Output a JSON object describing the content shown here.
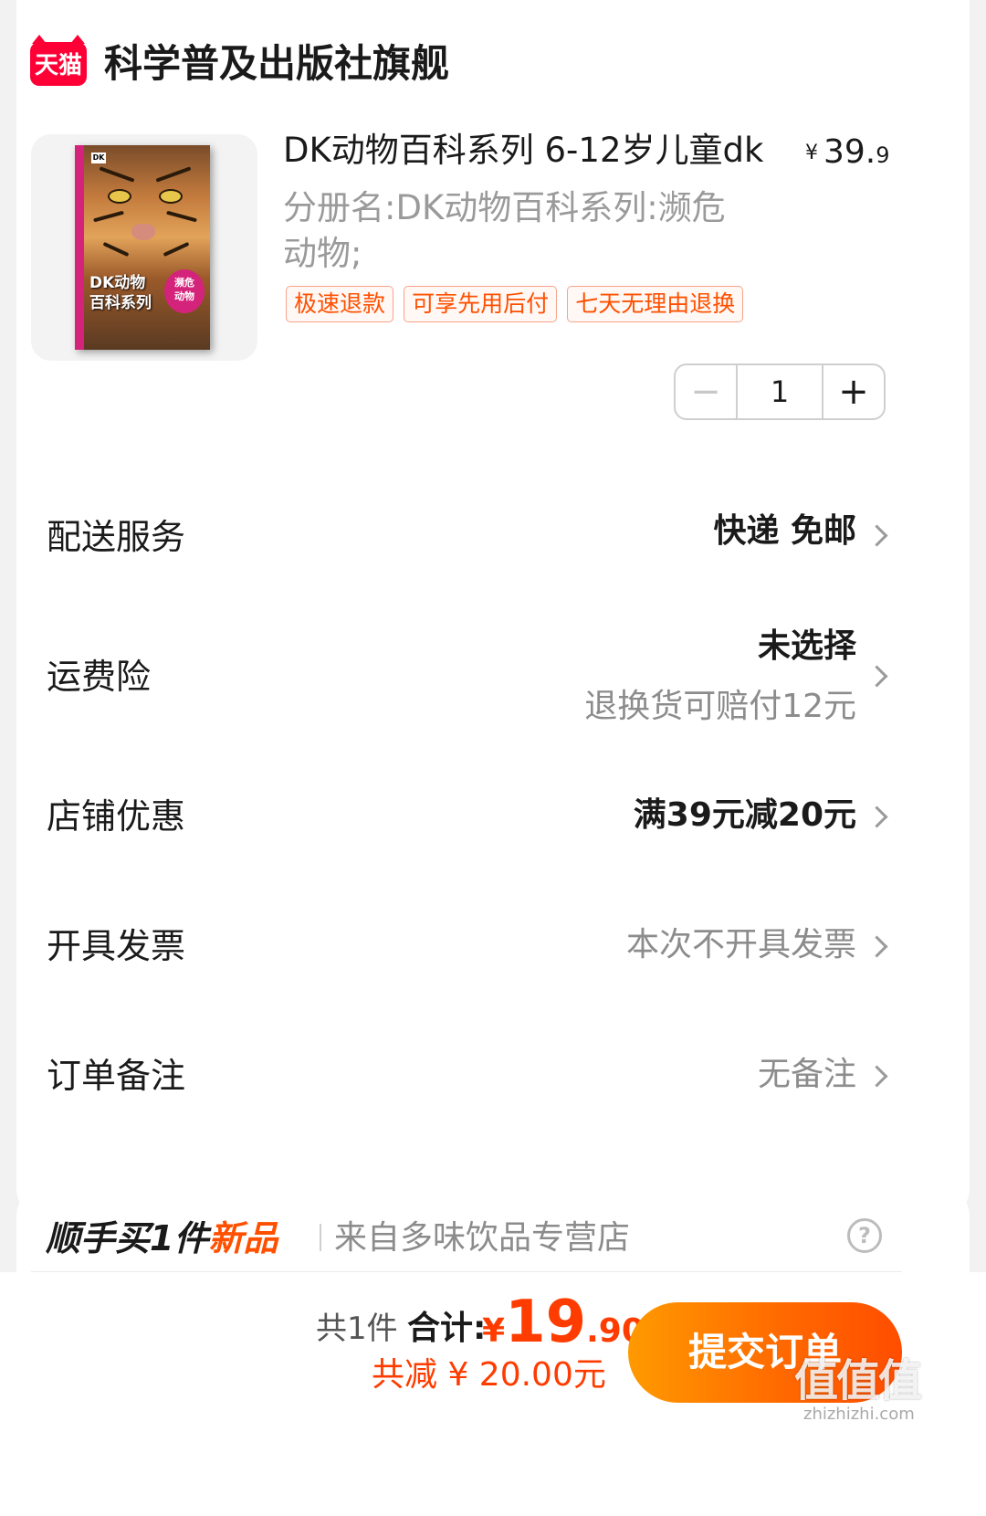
{
  "shop": {
    "logo_text": "天猫",
    "name": "科学普及出版社旗舰"
  },
  "product": {
    "title": "DK动物百科系列 6-12岁儿童dk",
    "price_currency": "¥",
    "price_int": "39.",
    "price_dec": "9",
    "sku": "分册名:DK动物百科系列:濒危动物;",
    "cover": {
      "title_line1": "DK动物",
      "title_line2": "百科系列",
      "badge_line1": "濒危",
      "badge_line2": "动物",
      "logo": "DK"
    },
    "tags": [
      "极速退款",
      "可享先用后付",
      "七天无理由退换"
    ],
    "quantity": "1",
    "minus": "−",
    "plus": "+"
  },
  "rows": {
    "delivery": {
      "label": "配送服务",
      "value": "快递 免邮"
    },
    "insurance": {
      "label": "运费险",
      "value": "未选择",
      "sub": "退换货可赔付12元"
    },
    "discount": {
      "label": "店铺优惠",
      "value": "满39元减20元"
    },
    "invoice": {
      "label": "开具发票",
      "value": "本次不开具发票"
    },
    "note": {
      "label": "订单备注",
      "value": "无备注"
    }
  },
  "addon": {
    "title_prefix": "顺手买1件",
    "title_highlight": "新品",
    "from": "来自多味饮品专营店",
    "help": "?"
  },
  "footer": {
    "count": "共1件",
    "total_label": "合计:",
    "total_currency": "¥",
    "total_int": "19",
    "total_dec": ".90",
    "saved": "共减 ¥ 20.00元",
    "submit": "提交订单"
  },
  "watermark": {
    "text": "值值值",
    "url": "zhizhizhi.com"
  },
  "colors": {
    "accent": "#ff5000",
    "price_red": "#ff3c00",
    "tmall_red": "#ff0036"
  }
}
